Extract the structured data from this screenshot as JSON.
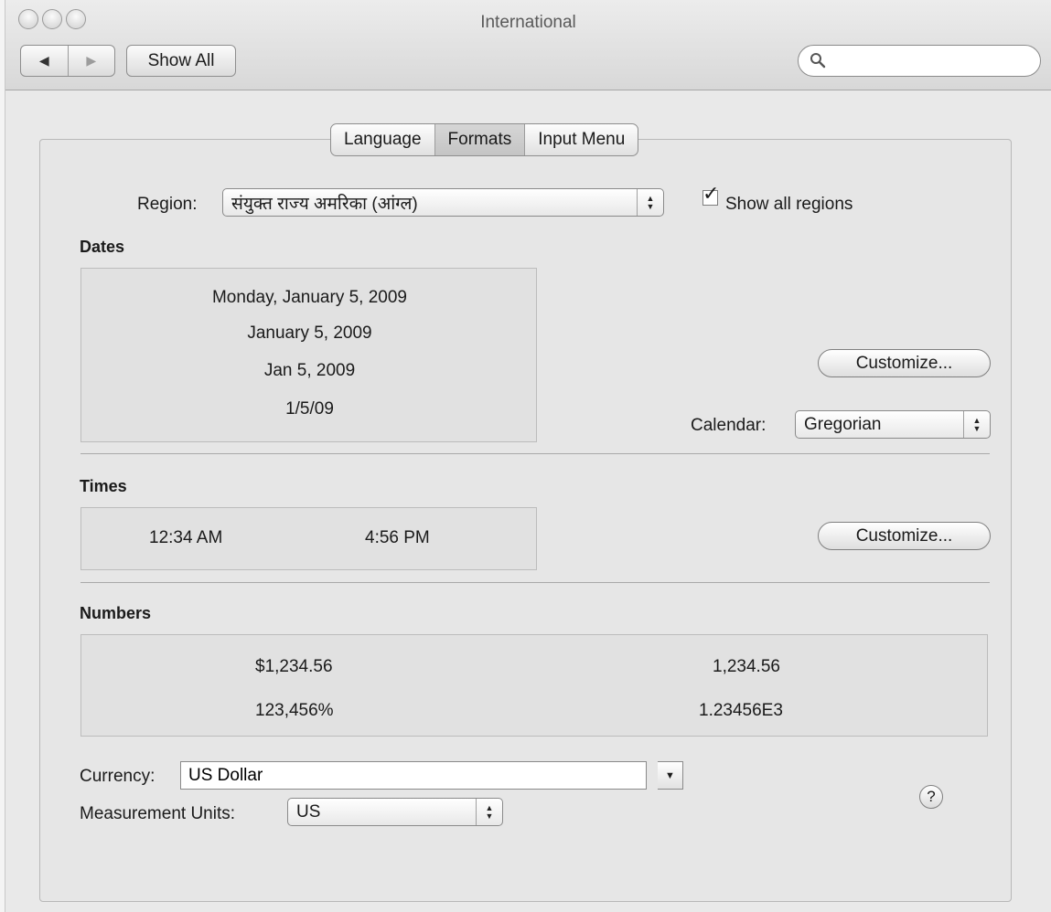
{
  "window": {
    "title": "International"
  },
  "toolbar": {
    "back_icon": "triangle-left-icon",
    "forward_icon": "triangle-right-icon",
    "show_all_label": "Show All",
    "search_value": "",
    "search_placeholder": ""
  },
  "tabs": [
    {
      "label": "Language",
      "selected": false
    },
    {
      "label": "Formats",
      "selected": true
    },
    {
      "label": "Input Menu",
      "selected": false
    }
  ],
  "region": {
    "label": "Region:",
    "value": "संयुक्त राज्य अमरिका (आंग्ल)",
    "show_all_label": "Show all regions",
    "show_all_checked": true
  },
  "dates": {
    "heading": "Dates",
    "samples": [
      "Monday, January 5, 2009",
      "January 5, 2009",
      "Jan 5, 2009",
      "1/5/09"
    ],
    "customize_label": "Customize...",
    "calendar_label": "Calendar:",
    "calendar_value": "Gregorian"
  },
  "times": {
    "heading": "Times",
    "samples": [
      "12:34 AM",
      "4:56 PM"
    ],
    "customize_label": "Customize..."
  },
  "numbers": {
    "heading": "Numbers",
    "samples": [
      "$1,234.56",
      "1,234.56",
      "123,456%",
      "1.23456E3"
    ]
  },
  "currency": {
    "label": "Currency:",
    "value": "US Dollar"
  },
  "measurement": {
    "label": "Measurement Units:",
    "value": "US"
  },
  "help_label": "?"
}
